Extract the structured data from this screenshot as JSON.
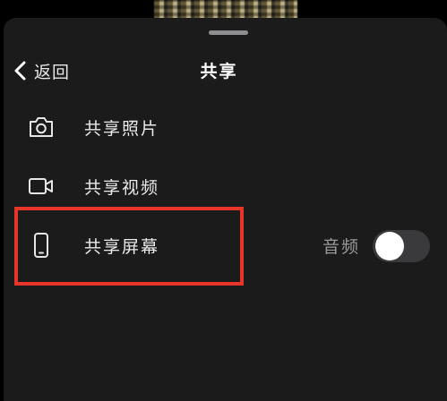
{
  "header": {
    "back_label": "返回",
    "title": "共享"
  },
  "options": [
    {
      "label": "共享照片",
      "icon": "camera-icon"
    },
    {
      "label": "共享视频",
      "icon": "video-camera-icon"
    },
    {
      "label": "共享屏幕",
      "icon": "phone-icon",
      "highlighted": true
    }
  ],
  "audio": {
    "label": "音频",
    "enabled": false
  },
  "colors": {
    "sheet_background": "#1b1b1c",
    "highlight": "#e8342b",
    "toggle_off": "#3a3a3c"
  }
}
